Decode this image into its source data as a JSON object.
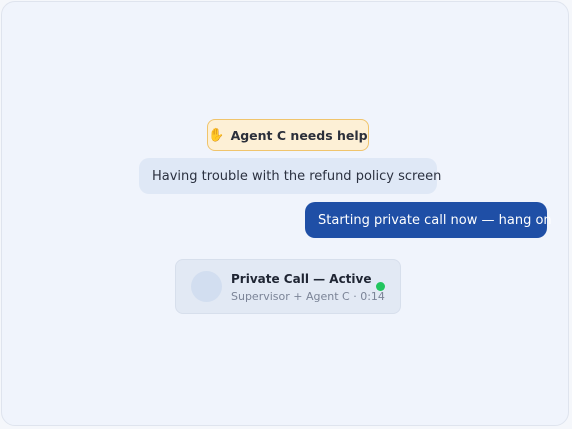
{
  "alert": {
    "icon": "raised-hand-icon",
    "icon_glyph": "✋",
    "text": "Agent C needs help",
    "background": "#fdf0d6",
    "border": "#f0c46c"
  },
  "messages": [
    {
      "direction": "incoming",
      "text": "Having trouble with the refund policy screen",
      "background": "#dfe8f6"
    },
    {
      "direction": "outgoing",
      "text": "Starting private call now — hang on",
      "background": "#1f4fa6"
    }
  ],
  "call": {
    "title": "Private Call — Active",
    "subtitle": "Supervisor + Agent C · 0:14",
    "status_color": "#22c55e"
  }
}
